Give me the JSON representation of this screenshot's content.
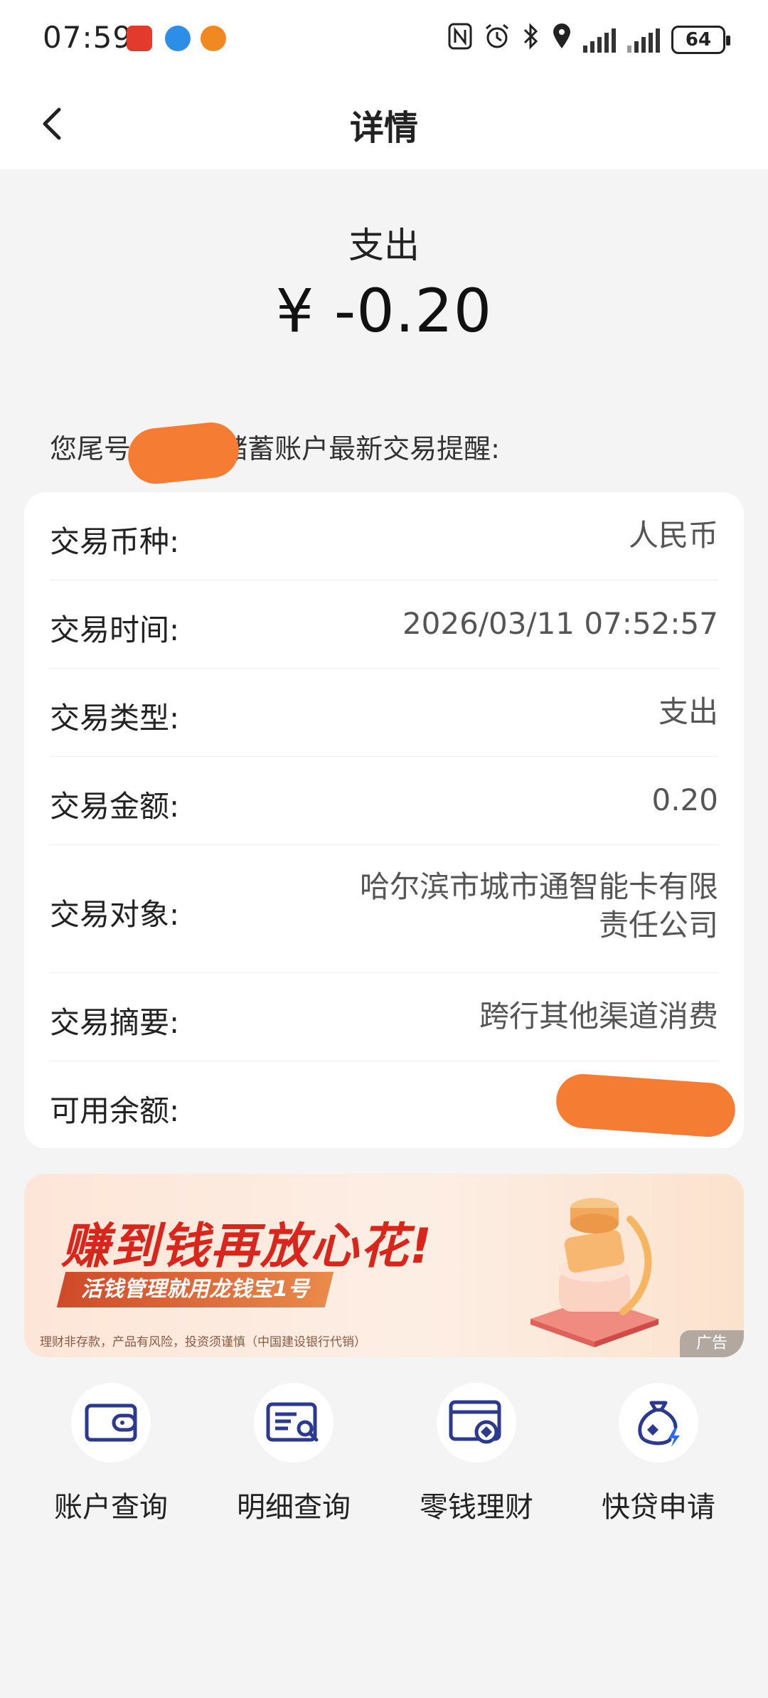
{
  "status_bar": {
    "time": "07:59",
    "battery": "64"
  },
  "nav": {
    "title": "详情"
  },
  "summary": {
    "type_label": "支出",
    "amount": "¥ -0.20",
    "notice": "您尾号 ****的储蓄账户最新交易提醒:"
  },
  "details": {
    "rows": [
      {
        "label": "交易币种:",
        "value": "人民币"
      },
      {
        "label": "交易时间:",
        "value": "2026/03/11 07:52:57"
      },
      {
        "label": "交易类型:",
        "value": "支出"
      },
      {
        "label": "交易金额:",
        "value": "0.20"
      },
      {
        "label": "交易对象:",
        "value": "哈尔滨市城市通智能卡有限责任公司"
      },
      {
        "label": "交易摘要:",
        "value": "跨行其他渠道消费"
      },
      {
        "label": "可用余额:",
        "value": ""
      }
    ]
  },
  "banner": {
    "headline": "赚到钱再放心花!",
    "subline": "活钱管理就用龙钱宝1号",
    "disclaimer": "理财非存款，产品有风险，投资须谨慎（中国建设银行代销）",
    "ad_tag": "广告"
  },
  "quick_actions": [
    {
      "label": "账户查询",
      "icon": "wallet-icon"
    },
    {
      "label": "明细查询",
      "icon": "statement-search-icon"
    },
    {
      "label": "零钱理财",
      "icon": "card-finance-icon"
    },
    {
      "label": "快贷申请",
      "icon": "loan-bag-icon"
    }
  ],
  "colors": {
    "accent_blue": "#2b3a8f",
    "redaction_orange": "#f57d33",
    "banner_red": "#d8261d"
  }
}
